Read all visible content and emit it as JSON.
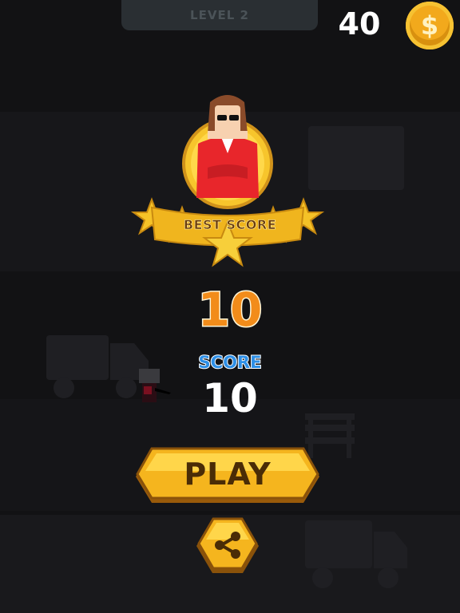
{
  "header": {
    "level_label": "LEVEL 2",
    "coins": "40",
    "coin_symbol": "$"
  },
  "result": {
    "best_score_label": "BEST SCORE",
    "best_score_value": "10",
    "score_label": "SCORE",
    "score_value": "10"
  },
  "actions": {
    "play_label": "PLAY",
    "share_icon": "share-icon"
  },
  "colors": {
    "background": "#121214",
    "gold": "#f5b51e",
    "best_score": "#f28c1a",
    "score_label": "#2e8fe6",
    "player_jacket": "#e8262b"
  }
}
